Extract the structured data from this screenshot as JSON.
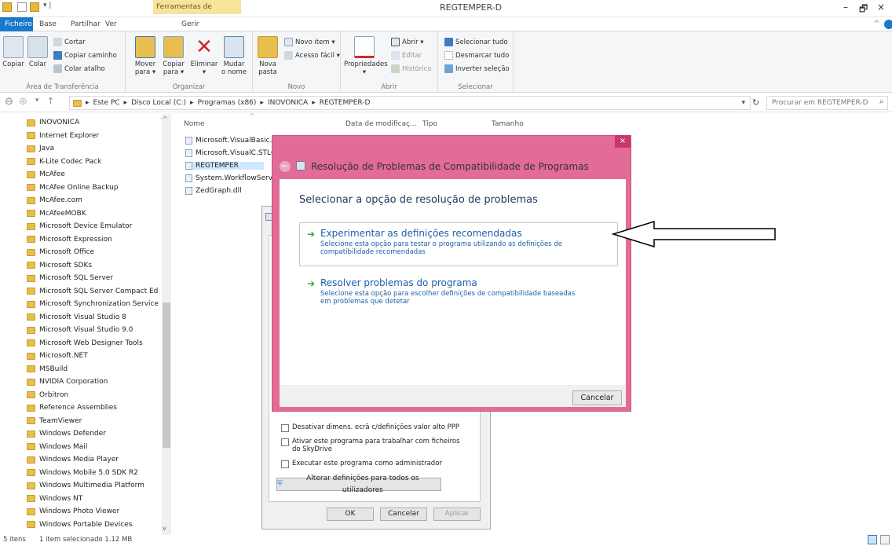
{
  "window": {
    "title": "REGTEMPER-D",
    "context_tab": "Ferramentas de Aplicação"
  },
  "ribbon_tabs": [
    "Ficheiro",
    "Base",
    "Partilhar",
    "Ver",
    "Gerir"
  ],
  "ribbon": {
    "clipboard": {
      "copy": "Copiar",
      "paste": "Colar",
      "cut": "Cortar",
      "copy_path": "Copiar caminho",
      "paste_shortcut": "Colar atalho",
      "label": "Área de Transferência"
    },
    "organize": {
      "move_1": "Mover",
      "move_2": "para ▾",
      "copy_1": "Copiar",
      "copy_2": "para ▾",
      "delete_1": "Eliminar",
      "delete_2": "▾",
      "rename_1": "Mudar",
      "rename_2": "o nome",
      "label": "Organizar"
    },
    "new": {
      "folder_1": "Nova",
      "folder_2": "pasta",
      "new_item": "Novo item ▾",
      "easy_access": "Acesso fácil ▾",
      "label": "Novo"
    },
    "open": {
      "properties_1": "Propriedades",
      "properties_2": "▾",
      "open": "Abrir ▾",
      "edit": "Editar",
      "history": "Histórico",
      "label": "Abrir"
    },
    "select": {
      "all": "Selecionar tudo",
      "none": "Desmarcar tudo",
      "invert": "Inverter seleção",
      "label": "Selecionar"
    }
  },
  "address": {
    "crumbs": [
      "Este PC",
      "Disco Local (C:)",
      "Programas (x86)",
      "INOVONICA",
      "REGTEMPER-D"
    ],
    "search_placeholder": "Procurar em REGTEMPER-D"
  },
  "nav_items": [
    "INOVONICA",
    "Internet Explorer",
    "Java",
    "K-Lite Codec Pack",
    "McAfee",
    "McAfee Online Backup",
    "McAfee.com",
    "McAfeeMOBK",
    "Microsoft Device Emulator",
    "Microsoft Expression",
    "Microsoft Office",
    "Microsoft SDKs",
    "Microsoft SQL Server",
    "Microsoft SQL Server Compact Ed",
    "Microsoft Synchronization Service",
    "Microsoft Visual Studio 8",
    "Microsoft Visual Studio 9.0",
    "Microsoft Web Designer Tools",
    "Microsoft.NET",
    "MSBuild",
    "NVIDIA Corporation",
    "Orbitron",
    "Reference Assemblies",
    "TeamViewer",
    "Windows Defender",
    "Windows Mail",
    "Windows Media Player",
    "Windows Mobile 5.0 SDK R2",
    "Windows Multimedia Platform",
    "Windows NT",
    "Windows Photo Viewer",
    "Windows Portable Devices"
  ],
  "columns": {
    "name": "Nome",
    "date": "Data de modificaç...",
    "type": "Tipo",
    "size": "Tamanho"
  },
  "files": [
    "Microsoft.VisualBasic.P",
    "Microsoft.VisualC.STLC",
    "REGTEMPER",
    "System.WorkflowServic",
    "ZedGraph.dll"
  ],
  "properties": {
    "checks": [
      "Desativar dimens. ecrã c/definições valor alto PPP",
      "Ativar este programa para trabalhar com ficheiros do SkyDrive",
      "Executar este programa como administrador"
    ],
    "all_users": "Alterar definições para todos os utilizadores",
    "ok": "OK",
    "cancel": "Cancelar",
    "apply": "Aplicar"
  },
  "dialog": {
    "title": "Resolução de Problemas de Compatibilidade de Programas",
    "close": "×",
    "heading": "Selecionar a opção de resolução de problemas",
    "option1_title": "Experimentar as definições recomendadas",
    "option1_desc": "Selecione esta opção para testar o programa utilizando as definições de compatibilidade recomendadas",
    "option2_title": "Resolver problemas do programa",
    "option2_desc": "Selecione esta opção para escolher definições de compatibilidade baseadas em problemas que detetar",
    "cancel": "Cancelar"
  },
  "status": {
    "items": "5 itens",
    "selected": "1 item selecionado 1.12 MB"
  }
}
